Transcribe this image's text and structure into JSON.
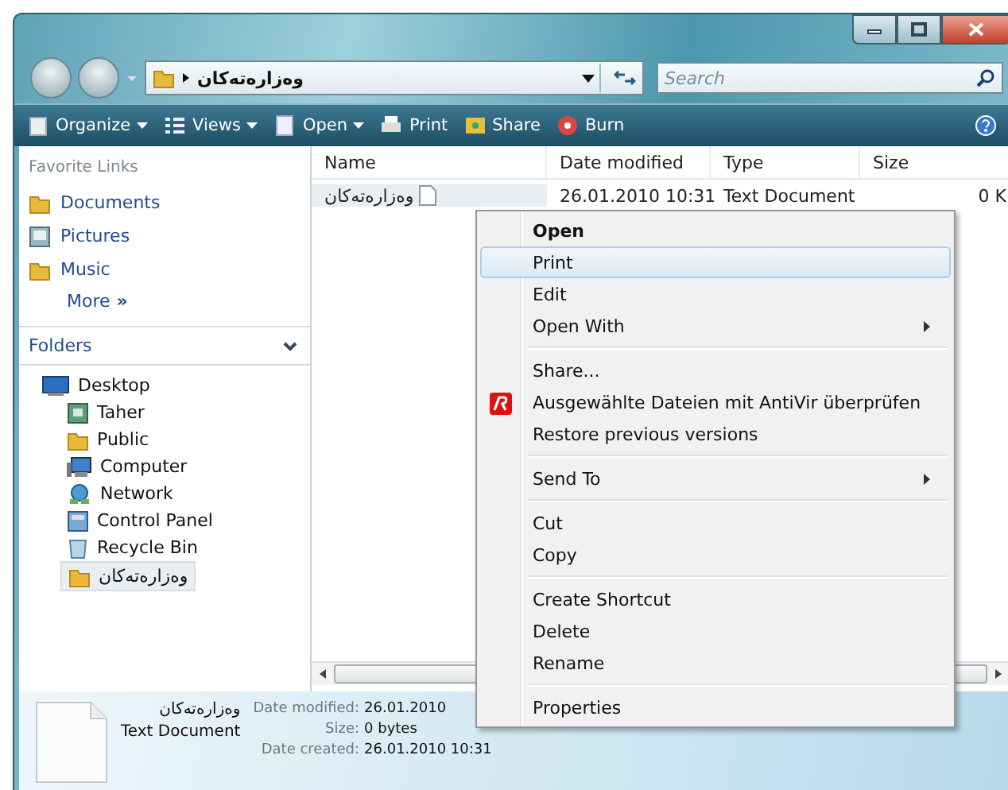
{
  "address_bar": {
    "path": "وەزارەتەکان"
  },
  "search": {
    "placeholder": "Search"
  },
  "toolbar": [
    {
      "label": "Organize",
      "dropdown": true
    },
    {
      "label": "Views",
      "dropdown": true
    },
    {
      "label": "Open",
      "dropdown": true
    },
    {
      "label": "Print",
      "dropdown": false
    },
    {
      "label": "Share",
      "dropdown": false
    },
    {
      "label": "Burn",
      "dropdown": false
    }
  ],
  "favorite_links": {
    "title": "Favorite Links",
    "items": [
      {
        "label": "Documents"
      },
      {
        "label": "Pictures"
      },
      {
        "label": "Music"
      }
    ],
    "more": "More",
    "more_glyph": "»"
  },
  "folders": {
    "title": "Folders",
    "expanded": true,
    "tree": [
      {
        "label": "Desktop",
        "selected": false,
        "children": [
          {
            "label": "Taher",
            "selected": false
          },
          {
            "label": "Public",
            "selected": false
          },
          {
            "label": "Computer",
            "selected": false
          },
          {
            "label": "Network",
            "selected": false
          },
          {
            "label": "Control Panel",
            "selected": false
          },
          {
            "label": "Recycle Bin",
            "selected": false
          },
          {
            "label": "وەزارەتەکان",
            "selected": true
          }
        ]
      }
    ]
  },
  "table": {
    "columns": [
      "Name",
      "Date modified",
      "Type",
      "Size"
    ],
    "rows": [
      {
        "cells": [
          "وەزارەتەکان",
          "26.01.2010 10:31",
          "Text Document",
          "0 K"
        ],
        "selected": true
      }
    ]
  },
  "context_menu": {
    "items": [
      {
        "kind": "item",
        "label": "Open",
        "default": true,
        "submenu": false,
        "selected": false
      },
      {
        "kind": "item",
        "label": "Print",
        "default": false,
        "submenu": false,
        "selected": true
      },
      {
        "kind": "item",
        "label": "Edit",
        "default": false,
        "submenu": false,
        "selected": false
      },
      {
        "kind": "item",
        "label": "Open With",
        "default": false,
        "submenu": true,
        "selected": false
      },
      {
        "kind": "separator"
      },
      {
        "kind": "item",
        "label": "Share...",
        "default": false,
        "submenu": false,
        "selected": false
      },
      {
        "kind": "antivir",
        "label": "Ausgewählte Dateien mit AntiVir überprüfen",
        "default": false,
        "submenu": false,
        "selected": false
      },
      {
        "kind": "item",
        "label": "Restore previous versions",
        "default": false,
        "submenu": false,
        "selected": false
      },
      {
        "kind": "separator"
      },
      {
        "kind": "item",
        "label": "Send To",
        "default": false,
        "submenu": true,
        "selected": false
      },
      {
        "kind": "separator"
      },
      {
        "kind": "item",
        "label": "Cut",
        "default": false,
        "submenu": false,
        "selected": false
      },
      {
        "kind": "item",
        "label": "Copy",
        "default": false,
        "submenu": false,
        "selected": false
      },
      {
        "kind": "separator"
      },
      {
        "kind": "item",
        "label": "Create Shortcut",
        "default": false,
        "submenu": false,
        "selected": false
      },
      {
        "kind": "item",
        "label": "Delete",
        "default": false,
        "submenu": false,
        "selected": false
      },
      {
        "kind": "item",
        "label": "Rename",
        "default": false,
        "submenu": false,
        "selected": false
      },
      {
        "kind": "separator"
      },
      {
        "kind": "item",
        "label": "Properties",
        "default": false,
        "submenu": false,
        "selected": false
      }
    ]
  },
  "details": {
    "name": "وەزارەتەکان",
    "type": "Text Document",
    "fields": [
      {
        "label": "Date modified:",
        "value": "26.01.2010"
      },
      {
        "label": "Size:",
        "value": "0 bytes"
      },
      {
        "label": "Date created:",
        "value": "26.01.2010 10:31"
      }
    ]
  }
}
